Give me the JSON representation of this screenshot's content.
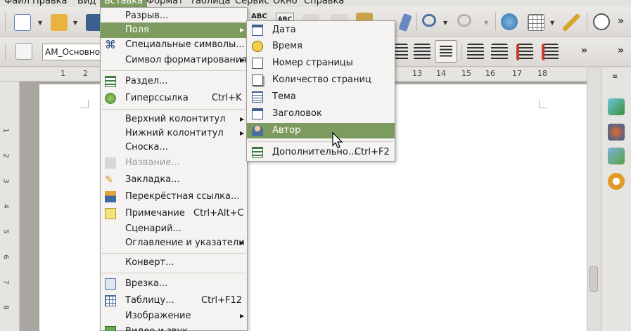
{
  "menubar": {
    "items": [
      {
        "label": "Файл"
      },
      {
        "label": "Правка"
      },
      {
        "label": "Вид"
      },
      {
        "label": "Вставка"
      },
      {
        "label": "Формат"
      },
      {
        "label": "Таблица"
      },
      {
        "label": "Сервис"
      },
      {
        "label": "Окно"
      },
      {
        "label": "Справка"
      }
    ]
  },
  "toolbar": {
    "spell_labels": [
      "ABC",
      "ABC"
    ],
    "paragraph_style": "АМ_Основной"
  },
  "ruler": {
    "horizontal_ticks": [
      "1",
      "2",
      "13",
      "14",
      "15",
      "16",
      "17",
      "18"
    ],
    "vertical_ticks": [
      "1",
      "2",
      "3",
      "4",
      "5",
      "6",
      "7",
      "8"
    ]
  },
  "insert_menu": {
    "items": [
      {
        "label": "Разрыв...",
        "accel": "",
        "submenu": false,
        "icon": "",
        "disabled": false
      },
      {
        "label": "Поля",
        "accel": "",
        "submenu": true,
        "icon": "",
        "disabled": false,
        "highlighted": true
      },
      {
        "label": "Специальные символы...",
        "accel": "",
        "submenu": false,
        "icon": "special-chars-icon",
        "disabled": false
      },
      {
        "label": "Символ форматирования",
        "accel": "",
        "submenu": true,
        "icon": "",
        "disabled": false
      },
      {
        "label": "Раздел...",
        "accel": "",
        "submenu": false,
        "icon": "section-icon",
        "disabled": false
      },
      {
        "label": "Гиперссылка",
        "accel": "Ctrl+K",
        "submenu": false,
        "icon": "hyperlink-icon",
        "disabled": false
      },
      {
        "label": "Верхний колонтитул",
        "accel": "",
        "submenu": true,
        "icon": "",
        "disabled": false
      },
      {
        "label": "Нижний колонтитул",
        "accel": "",
        "submenu": true,
        "icon": "",
        "disabled": false
      },
      {
        "label": "Сноска...",
        "accel": "",
        "submenu": false,
        "icon": "",
        "disabled": false
      },
      {
        "label": "Название...",
        "accel": "",
        "submenu": false,
        "icon": "caption-icon",
        "disabled": true
      },
      {
        "label": "Закладка...",
        "accel": "",
        "submenu": false,
        "icon": "bookmark-icon",
        "disabled": false
      },
      {
        "label": "Перекрёстная ссылка...",
        "accel": "",
        "submenu": false,
        "icon": "cross-reference-icon",
        "disabled": false
      },
      {
        "label": "Примечание",
        "accel": "Ctrl+Alt+C",
        "submenu": false,
        "icon": "comment-icon",
        "disabled": false
      },
      {
        "label": "Сценарий...",
        "accel": "",
        "submenu": false,
        "icon": "",
        "disabled": false
      },
      {
        "label": "Оглавление и указатели",
        "accel": "",
        "submenu": true,
        "icon": "",
        "disabled": false
      },
      {
        "label": "Конверт...",
        "accel": "",
        "submenu": false,
        "icon": "",
        "disabled": false
      },
      {
        "label": "Врезка...",
        "accel": "",
        "submenu": false,
        "icon": "frame-icon",
        "disabled": false
      },
      {
        "label": "Таблицу...",
        "accel": "Ctrl+F12",
        "submenu": false,
        "icon": "table-icon",
        "disabled": false
      },
      {
        "label": "Изображение",
        "accel": "",
        "submenu": true,
        "icon": "",
        "disabled": false
      },
      {
        "label": "Видео и звук",
        "accel": "",
        "submenu": false,
        "icon": "media-icon",
        "disabled": false
      }
    ]
  },
  "fields_submenu": {
    "items": [
      {
        "label": "Дата",
        "accel": "",
        "icon": "date-icon"
      },
      {
        "label": "Время",
        "accel": "",
        "icon": "clock-icon"
      },
      {
        "label": "Номер страницы",
        "accel": "",
        "icon": "page-number-icon"
      },
      {
        "label": "Количество страниц",
        "accel": "",
        "icon": "page-count-icon"
      },
      {
        "label": "Тема",
        "accel": "",
        "icon": "subject-icon"
      },
      {
        "label": "Заголовок",
        "accel": "",
        "icon": "title-icon"
      },
      {
        "label": "Автор",
        "accel": "",
        "icon": "author-icon",
        "highlighted": true
      },
      {
        "label": "Дополнительно...",
        "accel": "Ctrl+F2",
        "icon": "more-fields-icon"
      }
    ]
  },
  "colors": {
    "highlight": "#7d9b5e",
    "menu_bg": "#f4f3f1",
    "toolbar_bg": "#e4e2df"
  }
}
